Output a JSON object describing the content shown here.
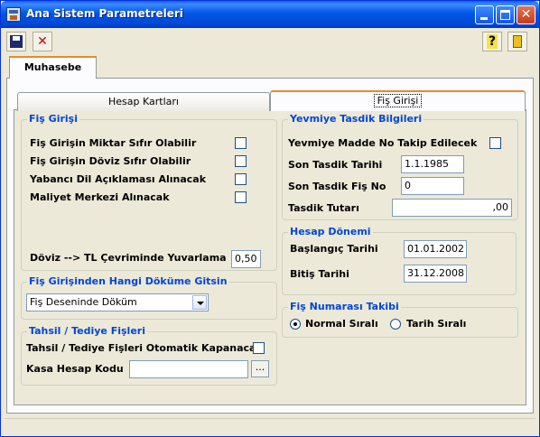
{
  "window": {
    "title": "Ana Sistem Parametreleri"
  },
  "toolbar": {
    "save": "save-icon",
    "delete": "delete-icon",
    "help": "?",
    "exit": "exit-icon"
  },
  "tabs": {
    "top": "Muhasebe",
    "hesap": "Hesap Kartları",
    "fis": "Fiş Girişi"
  },
  "fis_girisi": {
    "legend": "Fiş Girişi",
    "opt1": "Fiş Girişin Miktar Sıfır Olabilir",
    "opt2": "Fiş Girişin Döviz Sıfır Olabilir",
    "opt3": "Yabancı Dil Açıklaması Alınacak",
    "opt4": "Maliyet Merkezi Alınacak",
    "rounding_label": "Döviz --> TL Çevriminde Yuvarlama",
    "rounding_value": "0,50"
  },
  "dokum": {
    "legend": "Fiş Girişinden Hangi Döküme Gitsin",
    "selected": "Fiş Deseninde Döküm"
  },
  "tahsil": {
    "legend": "Tahsil / Tediye Fişleri",
    "auto_close": "Tahsil / Tediye Fişleri Otomatik Kapanacak",
    "kasa_label": "Kasa Hesap Kodu",
    "kasa_value": "",
    "browse": "..."
  },
  "yevmiye": {
    "legend": "Yevmiye Tasdik Bilgileri",
    "madde": "Yevmiye Madde No Takip Edilecek",
    "son_tarih_label": "Son Tasdik Tarihi",
    "son_tarih": "1.1.1985",
    "son_fis_label": "Son Tasdik Fiş No",
    "son_fis": "0",
    "tutar_label": "Tasdik Tutarı",
    "tutar": ",00"
  },
  "donem": {
    "legend": "Hesap Dönemi",
    "bas_label": "Başlangıç Tarihi",
    "bas": "01.01.2002",
    "bit_label": "Bitiş Tarihi",
    "bit": "31.12.2008"
  },
  "numara": {
    "legend": "Fiş Numarası Takibi",
    "normal": "Normal Sıralı",
    "tarih": "Tarih Sıralı"
  }
}
